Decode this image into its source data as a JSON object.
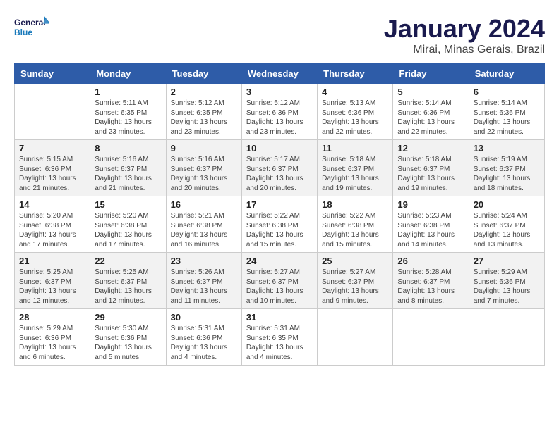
{
  "header": {
    "logo_line1": "General",
    "logo_line2": "Blue",
    "month_year": "January 2024",
    "location": "Mirai, Minas Gerais, Brazil"
  },
  "weekdays": [
    "Sunday",
    "Monday",
    "Tuesday",
    "Wednesday",
    "Thursday",
    "Friday",
    "Saturday"
  ],
  "weeks": [
    [
      {
        "day": "",
        "info": ""
      },
      {
        "day": "1",
        "info": "Sunrise: 5:11 AM\nSunset: 6:35 PM\nDaylight: 13 hours\nand 23 minutes."
      },
      {
        "day": "2",
        "info": "Sunrise: 5:12 AM\nSunset: 6:35 PM\nDaylight: 13 hours\nand 23 minutes."
      },
      {
        "day": "3",
        "info": "Sunrise: 5:12 AM\nSunset: 6:36 PM\nDaylight: 13 hours\nand 23 minutes."
      },
      {
        "day": "4",
        "info": "Sunrise: 5:13 AM\nSunset: 6:36 PM\nDaylight: 13 hours\nand 22 minutes."
      },
      {
        "day": "5",
        "info": "Sunrise: 5:14 AM\nSunset: 6:36 PM\nDaylight: 13 hours\nand 22 minutes."
      },
      {
        "day": "6",
        "info": "Sunrise: 5:14 AM\nSunset: 6:36 PM\nDaylight: 13 hours\nand 22 minutes."
      }
    ],
    [
      {
        "day": "7",
        "info": "Sunrise: 5:15 AM\nSunset: 6:36 PM\nDaylight: 13 hours\nand 21 minutes."
      },
      {
        "day": "8",
        "info": "Sunrise: 5:16 AM\nSunset: 6:37 PM\nDaylight: 13 hours\nand 21 minutes."
      },
      {
        "day": "9",
        "info": "Sunrise: 5:16 AM\nSunset: 6:37 PM\nDaylight: 13 hours\nand 20 minutes."
      },
      {
        "day": "10",
        "info": "Sunrise: 5:17 AM\nSunset: 6:37 PM\nDaylight: 13 hours\nand 20 minutes."
      },
      {
        "day": "11",
        "info": "Sunrise: 5:18 AM\nSunset: 6:37 PM\nDaylight: 13 hours\nand 19 minutes."
      },
      {
        "day": "12",
        "info": "Sunrise: 5:18 AM\nSunset: 6:37 PM\nDaylight: 13 hours\nand 19 minutes."
      },
      {
        "day": "13",
        "info": "Sunrise: 5:19 AM\nSunset: 6:37 PM\nDaylight: 13 hours\nand 18 minutes."
      }
    ],
    [
      {
        "day": "14",
        "info": "Sunrise: 5:20 AM\nSunset: 6:38 PM\nDaylight: 13 hours\nand 17 minutes."
      },
      {
        "day": "15",
        "info": "Sunrise: 5:20 AM\nSunset: 6:38 PM\nDaylight: 13 hours\nand 17 minutes."
      },
      {
        "day": "16",
        "info": "Sunrise: 5:21 AM\nSunset: 6:38 PM\nDaylight: 13 hours\nand 16 minutes."
      },
      {
        "day": "17",
        "info": "Sunrise: 5:22 AM\nSunset: 6:38 PM\nDaylight: 13 hours\nand 15 minutes."
      },
      {
        "day": "18",
        "info": "Sunrise: 5:22 AM\nSunset: 6:38 PM\nDaylight: 13 hours\nand 15 minutes."
      },
      {
        "day": "19",
        "info": "Sunrise: 5:23 AM\nSunset: 6:38 PM\nDaylight: 13 hours\nand 14 minutes."
      },
      {
        "day": "20",
        "info": "Sunrise: 5:24 AM\nSunset: 6:37 PM\nDaylight: 13 hours\nand 13 minutes."
      }
    ],
    [
      {
        "day": "21",
        "info": "Sunrise: 5:25 AM\nSunset: 6:37 PM\nDaylight: 13 hours\nand 12 minutes."
      },
      {
        "day": "22",
        "info": "Sunrise: 5:25 AM\nSunset: 6:37 PM\nDaylight: 13 hours\nand 12 minutes."
      },
      {
        "day": "23",
        "info": "Sunrise: 5:26 AM\nSunset: 6:37 PM\nDaylight: 13 hours\nand 11 minutes."
      },
      {
        "day": "24",
        "info": "Sunrise: 5:27 AM\nSunset: 6:37 PM\nDaylight: 13 hours\nand 10 minutes."
      },
      {
        "day": "25",
        "info": "Sunrise: 5:27 AM\nSunset: 6:37 PM\nDaylight: 13 hours\nand 9 minutes."
      },
      {
        "day": "26",
        "info": "Sunrise: 5:28 AM\nSunset: 6:37 PM\nDaylight: 13 hours\nand 8 minutes."
      },
      {
        "day": "27",
        "info": "Sunrise: 5:29 AM\nSunset: 6:36 PM\nDaylight: 13 hours\nand 7 minutes."
      }
    ],
    [
      {
        "day": "28",
        "info": "Sunrise: 5:29 AM\nSunset: 6:36 PM\nDaylight: 13 hours\nand 6 minutes."
      },
      {
        "day": "29",
        "info": "Sunrise: 5:30 AM\nSunset: 6:36 PM\nDaylight: 13 hours\nand 5 minutes."
      },
      {
        "day": "30",
        "info": "Sunrise: 5:31 AM\nSunset: 6:36 PM\nDaylight: 13 hours\nand 4 minutes."
      },
      {
        "day": "31",
        "info": "Sunrise: 5:31 AM\nSunset: 6:35 PM\nDaylight: 13 hours\nand 4 minutes."
      },
      {
        "day": "",
        "info": ""
      },
      {
        "day": "",
        "info": ""
      },
      {
        "day": "",
        "info": ""
      }
    ]
  ]
}
